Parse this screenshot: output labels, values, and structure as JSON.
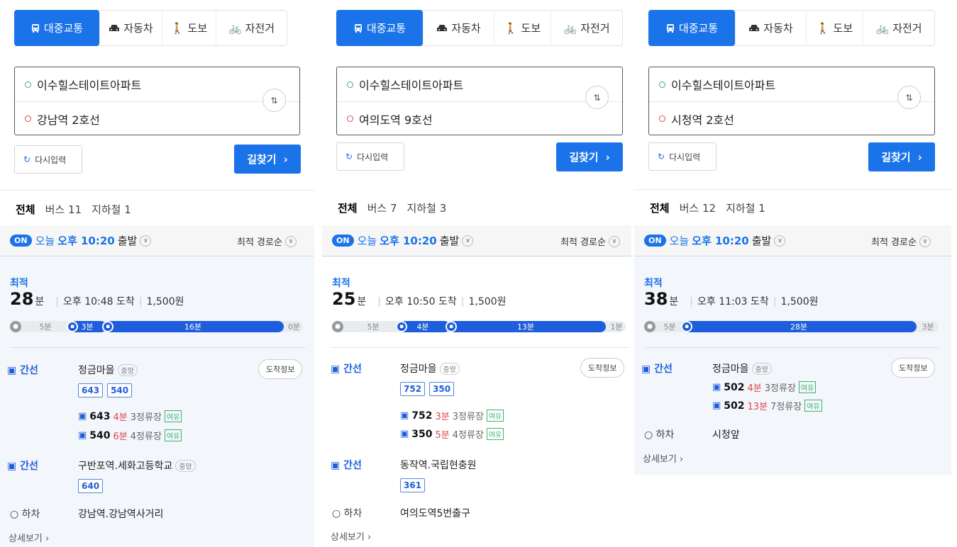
{
  "modes": [
    "대중교통",
    "자동차",
    "도보",
    "자전거"
  ],
  "reset_label": "다시입력",
  "search_label": "길찾기",
  "origin": "이수힐스테이트아파트",
  "depart_prefix": "오늘",
  "depart_time": "오후 10:20",
  "depart_suffix": "출발",
  "on_badge": "ON",
  "sort_label": "최적 경로순",
  "best_label": "최적",
  "all_tab": "전체",
  "details_label": "상세보기",
  "arrival_info_label": "도착정보",
  "busstop_tag": "중앙",
  "availability": "여유",
  "exit_label": "하차",
  "panels": [
    {
      "dest": "강남역 2호선",
      "tab_bus": "버스 11",
      "tab_sub": "지하철 1",
      "minutes": "28",
      "unit": "분",
      "arrive": "오후 10:48 도착",
      "fare": "1,500원",
      "bar": {
        "walk1": "5분",
        "bus1": "3분",
        "bus2": "16분",
        "walk2": "0분"
      },
      "leg1": {
        "type": "간선",
        "stop": "정금마을",
        "buses": [
          "643",
          "540"
        ],
        "arrivals": [
          {
            "bus": "643",
            "min": "4분",
            "stops": "3정류장"
          },
          {
            "bus": "540",
            "min": "6분",
            "stops": "4정류장"
          }
        ]
      },
      "leg2": {
        "type": "간선",
        "stop": "구반포역.세화고등학교",
        "buses": [
          "640"
        ]
      },
      "exit": "강남역.강남역사거리"
    },
    {
      "dest": "여의도역 9호선",
      "tab_bus": "버스 7",
      "tab_sub": "지하철 3",
      "minutes": "25",
      "unit": "분",
      "arrive": "오후 10:50 도착",
      "fare": "1,500원",
      "bar": {
        "walk1": "5분",
        "bus1": "4분",
        "bus2": "13분",
        "walk2": "1분"
      },
      "leg1": {
        "type": "간선",
        "stop": "정금마을",
        "buses": [
          "752",
          "350"
        ],
        "arrivals": [
          {
            "bus": "752",
            "min": "3분",
            "stops": "3정류장"
          },
          {
            "bus": "350",
            "min": "5분",
            "stops": "4정류장"
          }
        ]
      },
      "leg2": {
        "type": "간선",
        "stop": "동작역.국립현충원",
        "buses": [
          "361"
        ]
      },
      "exit": "여의도역5번출구"
    },
    {
      "dest": "시청역 2호선",
      "tab_bus": "버스 12",
      "tab_sub": "지하철 1",
      "minutes": "38",
      "unit": "분",
      "arrive": "오후 11:03 도착",
      "fare": "1,500원",
      "bar": {
        "walk1": "5분",
        "bus1": "28분",
        "walk2": "3분"
      },
      "leg1": {
        "type": "간선",
        "stop": "정금마을",
        "arrivals": [
          {
            "bus": "502",
            "min": "4분",
            "stops": "3정류장"
          },
          {
            "bus": "502",
            "min": "13분",
            "stops": "7정류장"
          }
        ]
      },
      "exit": "시청앞"
    }
  ]
}
